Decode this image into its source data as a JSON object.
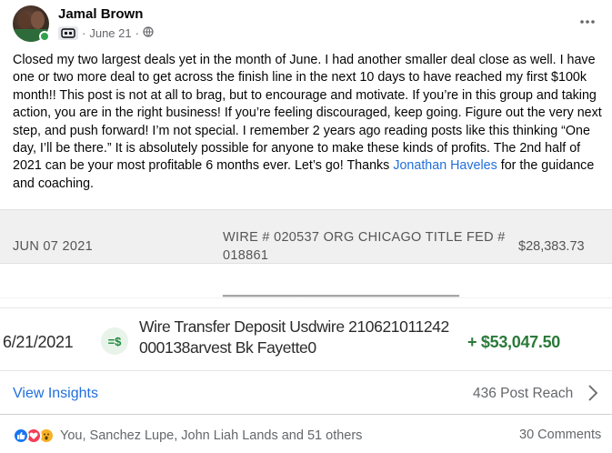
{
  "post": {
    "author": "Jamal Brown",
    "date": "June 21",
    "separator": "·",
    "text_before_mention": "Closed my two largest deals yet in the month of June. I had another smaller deal close as well.  I have one or two more deal to get across the finish line in the next 10 days to have reached my first $100k month!!  This post is not at all to brag, but to encourage and motivate.  If you’re in this group and taking action, you are in the right business!  If you’re feeling discouraged, keep going.  Figure out the very next step, and push forward!  I’m not special. I remember 2 years ago reading posts like this thinking “One day, I’ll be there.”  It is absolutely possible for anyone to make these kinds of profits.  The 2nd half of 2021 can be your most profitable 6 months ever. Let’s go!  Thanks ",
    "mention": "Jonathan Haveles",
    "text_after_mention": " for the guidance and coaching."
  },
  "image1": {
    "date": "JUN 07 2021",
    "description_line1": "WIRE # 020537 ORG CHICAGO TITLE FED #",
    "description_line2": "018861",
    "amount": "$28,383.73"
  },
  "image2": {
    "date": "6/21/2021",
    "icon_text": "=$",
    "description_line1": "Wire Transfer Deposit Usdwire 210621011242",
    "description_line2": "000138arvest Bk Fayette0",
    "amount": "+ $53,047.50"
  },
  "insights": {
    "link_label": "View Insights",
    "reach_label": "436 Post Reach"
  },
  "reactions": {
    "names": "You, Sanchez Lupe, John Liah Lands and 51 others",
    "comments": "30 Comments"
  },
  "colors": {
    "link": "#216fdb",
    "deposit_green": "#2b7a3a",
    "like_blue": "#1877f2",
    "love_red": "#f33e58",
    "wow_yellow": "#f7b125"
  }
}
